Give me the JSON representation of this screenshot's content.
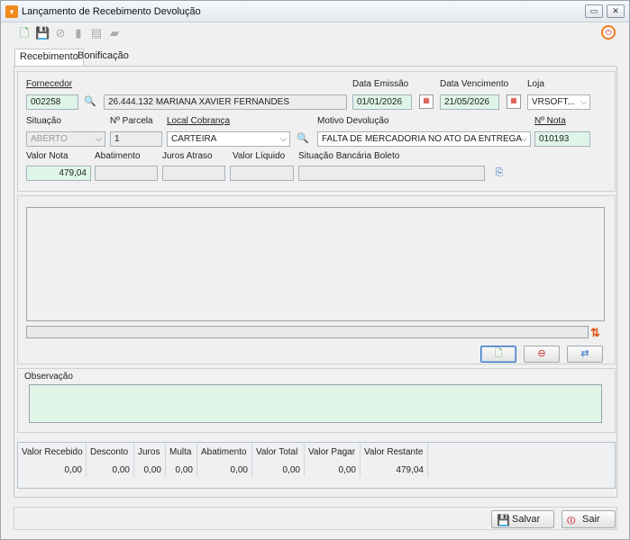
{
  "window": {
    "title": "Lançamento de Recebimento Devolução"
  },
  "tabs": [
    "Recebimento",
    "Bonificação"
  ],
  "form": {
    "fornecedor": {
      "label": "Fornecedor",
      "code": "002258",
      "name": "26.444.132 MARIANA XAVIER FERNANDES"
    },
    "data_emissao": {
      "label": "Data Emissão",
      "value": "01/01/2026"
    },
    "data_vencimento": {
      "label": "Data Vencimento",
      "value": "21/05/2026"
    },
    "loja": {
      "label": "Loja",
      "value": "VRSOFT..."
    },
    "situacao": {
      "label": "Situação",
      "value": "ABERTO"
    },
    "parcela": {
      "label": "Nº Parcela",
      "value": "1"
    },
    "local_cobranca": {
      "label": "Local Cobrança",
      "value": "CARTEIRA"
    },
    "motivo_devolucao": {
      "label": "Motivo Devolução",
      "value": "FALTA DE MERCADORIA NO ATO DA ENTREGA"
    },
    "numero_nota": {
      "label": "Nº Nota",
      "value": "010193"
    },
    "valor_nota": {
      "label": "Valor Nota",
      "value": "479,04"
    },
    "abatimento": {
      "label": "Abatimento",
      "value": ""
    },
    "juros_atraso": {
      "label": "Juros Atraso",
      "value": ""
    },
    "valor_liquido": {
      "label": "Valor Líquido",
      "value": ""
    },
    "situacao_boleto": {
      "label": "Situação Bancária Boleto",
      "value": ""
    }
  },
  "observacao": {
    "label": "Observação",
    "value": ""
  },
  "totals": [
    {
      "label": "Valor Recebido",
      "value": "0,00"
    },
    {
      "label": "Desconto",
      "value": "0,00"
    },
    {
      "label": "Juros",
      "value": "0,00"
    },
    {
      "label": "Multa",
      "value": "0,00"
    },
    {
      "label": "Abatimento",
      "value": "0,00"
    },
    {
      "label": "Valor Total",
      "value": "0,00"
    },
    {
      "label": "Valor Pagar",
      "value": "0,00"
    },
    {
      "label": "Valor Restante",
      "value": "479,04"
    }
  ],
  "buttons": {
    "salvar": "Salvar",
    "sair": "Sair"
  },
  "colors": {
    "required_field": "#dff5e8",
    "accent": "#f08a1c"
  }
}
